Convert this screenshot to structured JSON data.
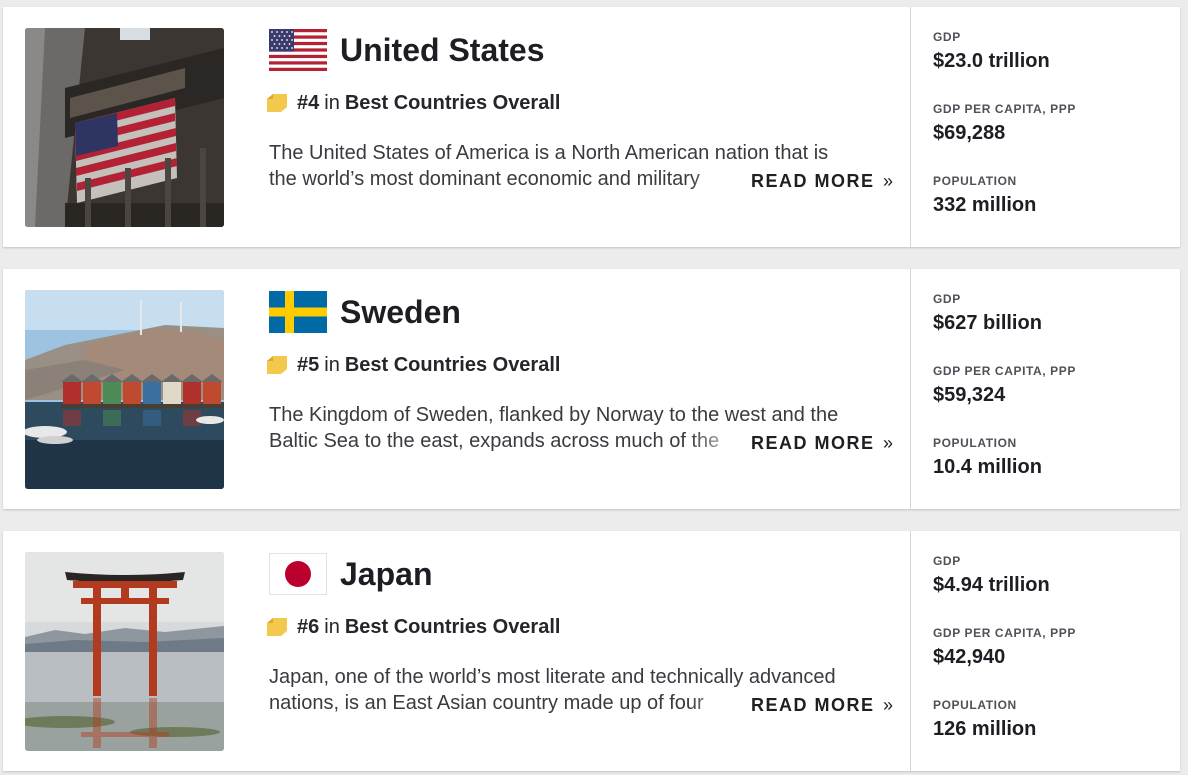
{
  "countries": [
    {
      "name": "United States",
      "rank": "#4",
      "rank_in": "in",
      "rank_category": "Best Countries Overall",
      "desc_line1": "The United States of America is a North American nation that is",
      "desc_line2": "the world’s most dominant economic and military",
      "read_more": "READ MORE",
      "read_more_arrow": "»",
      "stats": [
        {
          "label": "GDP",
          "value": "$23.0 trillion"
        },
        {
          "label": "GDP PER CAPITA, PPP",
          "value": "$69,288"
        },
        {
          "label": "POPULATION",
          "value": "332 million"
        }
      ],
      "flag_icon": "us-flag-icon",
      "photo": "new-york-stock-exchange-photo"
    },
    {
      "name": "Sweden",
      "rank": "#5",
      "rank_in": "in",
      "rank_category": "Best Countries Overall",
      "desc_line1": "The Kingdom of Sweden, flanked by Norway to the west and the",
      "desc_line2": "Baltic Sea to the east, expands across much of the",
      "read_more": "READ MORE",
      "read_more_arrow": "»",
      "stats": [
        {
          "label": "GDP",
          "value": "$627 billion"
        },
        {
          "label": "GDP PER CAPITA, PPP",
          "value": "$59,324"
        },
        {
          "label": "POPULATION",
          "value": "10.4 million"
        }
      ],
      "flag_icon": "sweden-flag-icon",
      "photo": "swedish-boathouses-photo"
    },
    {
      "name": "Japan",
      "rank": "#6",
      "rank_in": "in",
      "rank_category": "Best Countries Overall",
      "desc_line1": "Japan, one of the world’s most literate and technically advanced",
      "desc_line2": "nations, is an East Asian country made up of four",
      "read_more": "READ MORE",
      "read_more_arrow": "»",
      "stats": [
        {
          "label": "GDP",
          "value": "$4.94 trillion"
        },
        {
          "label": "GDP PER CAPITA, PPP",
          "value": "$42,940"
        },
        {
          "label": "POPULATION",
          "value": "126 million"
        }
      ],
      "flag_icon": "japan-flag-icon",
      "photo": "torii-gate-photo"
    }
  ],
  "colors": {
    "badge_gold": "#f2c94c",
    "us_red": "#b22234",
    "us_blue": "#3c3b6e",
    "se_blue": "#006aa7",
    "se_yellow": "#fecc00",
    "jp_red": "#bc002d"
  }
}
